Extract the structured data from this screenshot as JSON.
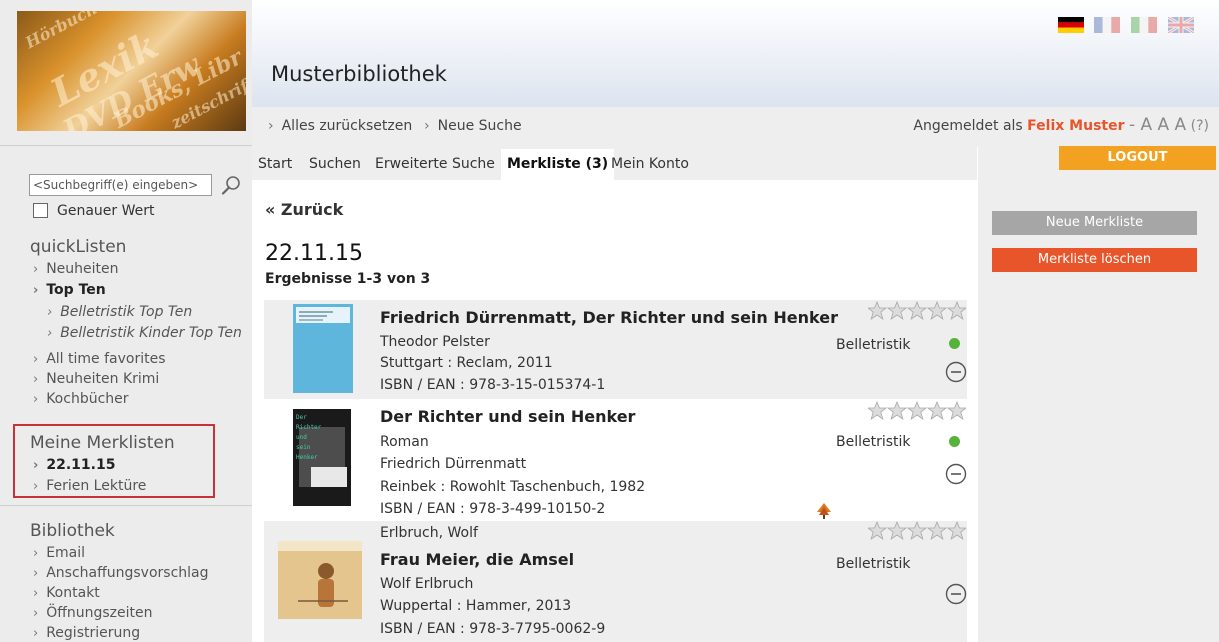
{
  "header": {
    "title": "Musterbibliothek",
    "flags": [
      "de",
      "fr",
      "it",
      "uk"
    ],
    "sublinks": [
      "Alles zurücksetzen",
      "Neue Suche"
    ],
    "login_prefix": "Angemeldet als",
    "user": "Felix Muster",
    "sizes": "- A A A",
    "help": "(?)"
  },
  "logo_words": [
    "Lexik",
    "DVD Erw",
    "Books, Libr",
    "zeitschrift",
    "Hörbuch"
  ],
  "search": {
    "placeholder": "<Suchbegriff(e) eingeben>",
    "exact_label": "Genauer Wert"
  },
  "quicklists": {
    "heading": "quickListen",
    "items": [
      "Neuheiten",
      "Top Ten",
      "All time favorites",
      "Neuheiten Krimi",
      "Kochbücher"
    ],
    "top_ten_subs": [
      "Belletristik Top Ten",
      "Belletristik Kinder Top Ten"
    ]
  },
  "merklisten": {
    "heading": "Meine Merklisten",
    "items": [
      "22.11.15",
      "Ferien Lektüre"
    ]
  },
  "library": {
    "heading": "Bibliothek",
    "items": [
      "Email",
      "Anschaffungsvorschlag",
      "Kontakt",
      "Öffnungszeiten",
      "Registrierung"
    ]
  },
  "tabs": [
    "Start",
    "Suchen",
    "Erweiterte Suche",
    "Merkliste (3)",
    "Mein Konto"
  ],
  "active_tab": "Merkliste (3)",
  "sidebar_right": {
    "logout": "LOGOUT",
    "new_list": "Neue Merkliste",
    "delete_list": "Merkliste löschen"
  },
  "main": {
    "back": "« Zurück",
    "list_title": "22.11.15",
    "result_count": "Ergebnisse 1-3 von 3"
  },
  "results": [
    {
      "title": "Friedrich Dürrenmatt, Der Richter und sein Henker",
      "lines": [
        "Theodor Pelster",
        "Stuttgart : Reclam, 2011",
        "ISBN / EAN : 978-3-15-015374-1"
      ],
      "genre": "Belletristik",
      "available": true
    },
    {
      "title": "Der Richter und sein Henker",
      "lines": [
        "Roman",
        "Friedrich Dürrenmatt",
        "Reinbek : Rowohlt Taschenbuch, 1982",
        "ISBN / EAN : 978-3-499-10150-2"
      ],
      "genre": "Belletristik",
      "available": true
    },
    {
      "pre": "Erlbruch, Wolf",
      "title": "Frau Meier, die Amsel",
      "lines": [
        "Wolf Erlbruch",
        "Wuppertal : Hammer, 2013",
        "ISBN / EAN : 978-3-7795-0062-9"
      ],
      "genre": "Belletristik",
      "available": false
    }
  ],
  "colors": {
    "accent": "#e9552a",
    "logout": "#f2a121",
    "available": "#55b33b",
    "frame": "#c8323a"
  },
  "icons": [
    "search-icon",
    "star-rating-icon",
    "availability-icon",
    "remove-icon",
    "chevron-right-icon"
  ]
}
